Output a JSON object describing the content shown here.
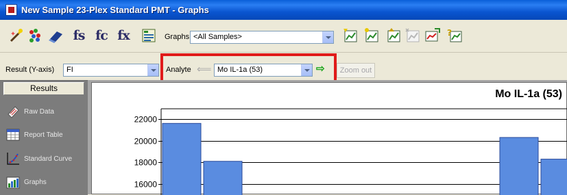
{
  "window": {
    "title": "New Sample 23-Plex Standard PMT - Graphs"
  },
  "toolbar": {
    "icons": [
      "wand-icon",
      "scatter-dots-icon",
      "eraser-icon",
      "fs-icon",
      "fc-icon",
      "fx-icon",
      "table-grid-icon"
    ],
    "fs_text": "fs",
    "fc_text": "fc",
    "fx_text": "fx",
    "graphs_label": "Graphs",
    "graphs_value": "<All Samples>",
    "right_icons": [
      "chart-1-icon",
      "chart-2-icon",
      "chart-3-icon",
      "chart-disabled-icon",
      "chart-export-icon",
      "chart-help-icon"
    ]
  },
  "filters": {
    "result_label": "Result (Y-axis)",
    "result_value": "FI",
    "analyte_label": "Analyte",
    "analyte_value": "Mo IL-1a (53)",
    "zoom_out_label": "Zoom out"
  },
  "sidebar": {
    "header": "Results",
    "items": [
      {
        "label": "Raw Data",
        "icon": "raw-data-icon"
      },
      {
        "label": "Report Table",
        "icon": "report-table-icon"
      },
      {
        "label": "Standard Curve",
        "icon": "standard-curve-icon"
      },
      {
        "label": "Graphs",
        "icon": "graphs-icon"
      }
    ]
  },
  "colors": {
    "bar_fill": "#5a8ce0",
    "highlight": "#e01a1a",
    "titlebar": "#0a5fd8"
  },
  "chart_data": {
    "type": "bar",
    "title": "Mo IL-1a (53)",
    "y_ticks": [
      16000,
      18000,
      20000,
      22000
    ],
    "ylim": [
      15000,
      23500
    ],
    "grid": true,
    "values_visible": [
      21600,
      18100,
      20300,
      18300
    ],
    "bar_indices": [
      0,
      1,
      16,
      17
    ]
  }
}
